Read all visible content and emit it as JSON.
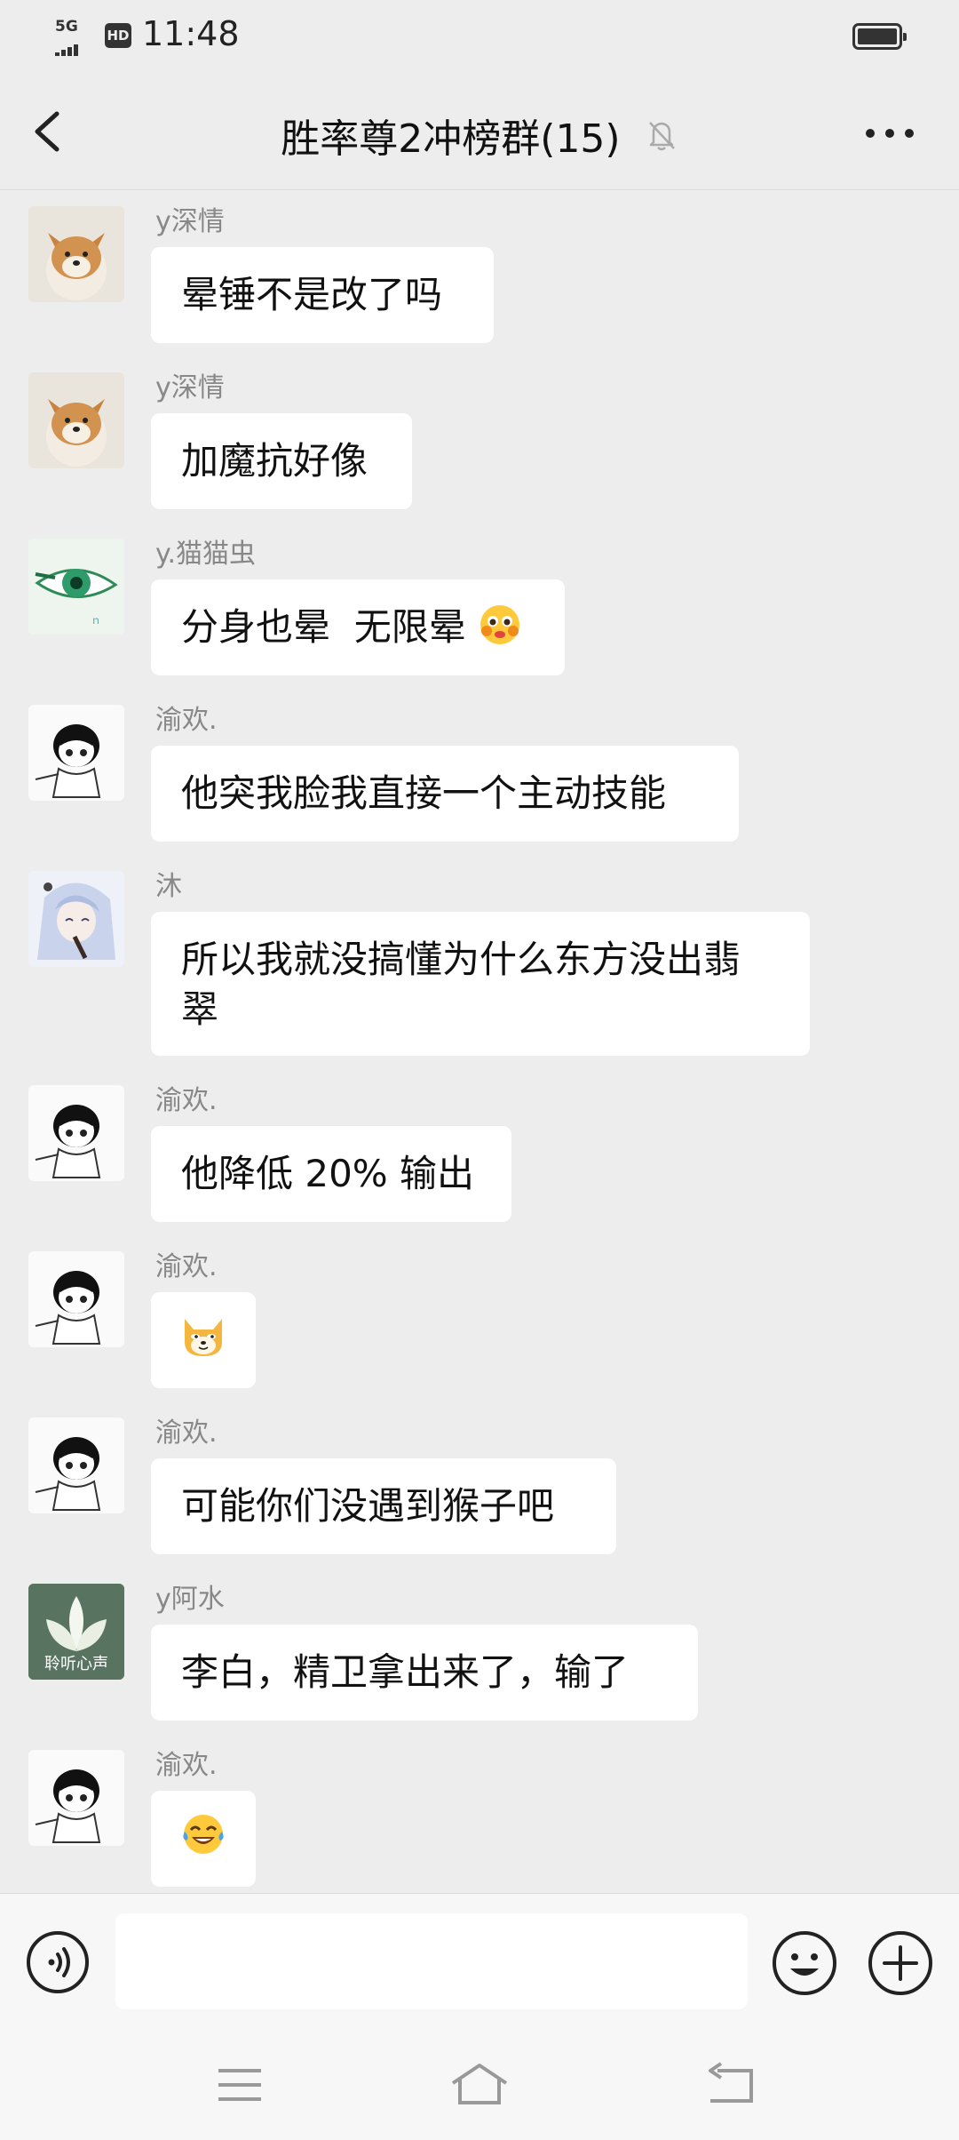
{
  "status_bar": {
    "network": "5G",
    "hd": "HD",
    "time": "11:48"
  },
  "header": {
    "title": "胜率尊2冲榜群(15)"
  },
  "messages": [
    {
      "sender": "y深情",
      "text": "晕锤不是改了吗",
      "avatar": "shiba-dog-avatar"
    },
    {
      "sender": "y深情",
      "text": "加魔抗好像",
      "avatar": "shiba-dog-avatar"
    },
    {
      "sender": "y.猫猫虫",
      "text": "分身也晕  无限晕",
      "emoji": "pleading-face-emoji",
      "avatar": "green-eye-avatar"
    },
    {
      "sender": "渝欢.",
      "text": "他突我脸我直接一个主动技能",
      "avatar": "anime-boy-avatar"
    },
    {
      "sender": "沐",
      "text": "所以我就没搞懂为什么东方没出翡\n翠",
      "avatar": "anime-girl-avatar"
    },
    {
      "sender": "渝欢.",
      "text": "他降低 20% 输出",
      "avatar": "anime-boy-avatar"
    },
    {
      "sender": "渝欢.",
      "text": "",
      "emoji": "doge-emoji",
      "avatar": "anime-boy-avatar"
    },
    {
      "sender": "渝欢.",
      "text": "可能你们没遇到猴子吧",
      "avatar": "anime-boy-avatar"
    },
    {
      "sender": "y阿水",
      "text": "李白，精卫拿出来了，输了",
      "avatar": "lotus-avatar",
      "avatar_caption": "聆听心声"
    },
    {
      "sender": "渝欢.",
      "text": "",
      "emoji": "tears-of-joy-emoji",
      "avatar": "anime-boy-avatar"
    }
  ],
  "input": {
    "value": "",
    "placeholder": ""
  },
  "colors": {
    "background": "#ededed",
    "bubble": "#ffffff",
    "sender": "#888888",
    "bar": "#f7f7f7"
  }
}
